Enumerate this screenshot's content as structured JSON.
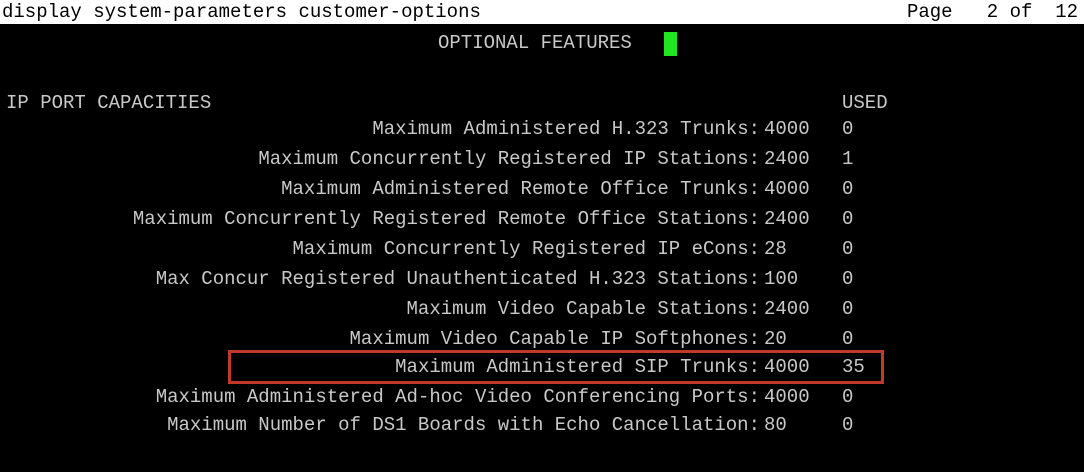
{
  "command": "display system-parameters customer-options",
  "page_info": "Page   2 of  12",
  "title": "OPTIONAL FEATURES",
  "section_header": "IP PORT CAPACITIES",
  "used_header": "USED",
  "rows": [
    {
      "label": "Maximum Administered H.323 Trunks:",
      "capacity": "4000",
      "used": "0"
    },
    {
      "label": "Maximum Concurrently Registered IP Stations:",
      "capacity": "2400",
      "used": "1"
    },
    {
      "label": "Maximum Administered Remote Office Trunks:",
      "capacity": "4000",
      "used": "0"
    },
    {
      "label": "Maximum Concurrently Registered Remote Office Stations:",
      "capacity": "2400",
      "used": "0"
    },
    {
      "label": "Maximum Concurrently Registered IP eCons:",
      "capacity": "28",
      "used": "0"
    },
    {
      "label": "Max Concur Registered Unauthenticated H.323 Stations:",
      "capacity": "100",
      "used": "0"
    },
    {
      "label": "Maximum Video Capable Stations:",
      "capacity": "2400",
      "used": "0"
    },
    {
      "label": "Maximum Video Capable IP Softphones:",
      "capacity": "20",
      "used": "0"
    },
    {
      "label": "Maximum Administered SIP Trunks:",
      "capacity": "4000",
      "used": "35"
    },
    {
      "label": "Maximum Administered Ad-hoc Video Conferencing Ports:",
      "capacity": "4000",
      "used": "0"
    },
    {
      "label": "Maximum Number of DS1 Boards with Echo Cancellation:",
      "capacity": "80",
      "used": "0"
    }
  ],
  "colors": {
    "background": "#000000",
    "text": "#c8c8c8",
    "command_bar": "#ffffff",
    "cursor": "#22e522",
    "highlight_box": "#c0392b"
  }
}
